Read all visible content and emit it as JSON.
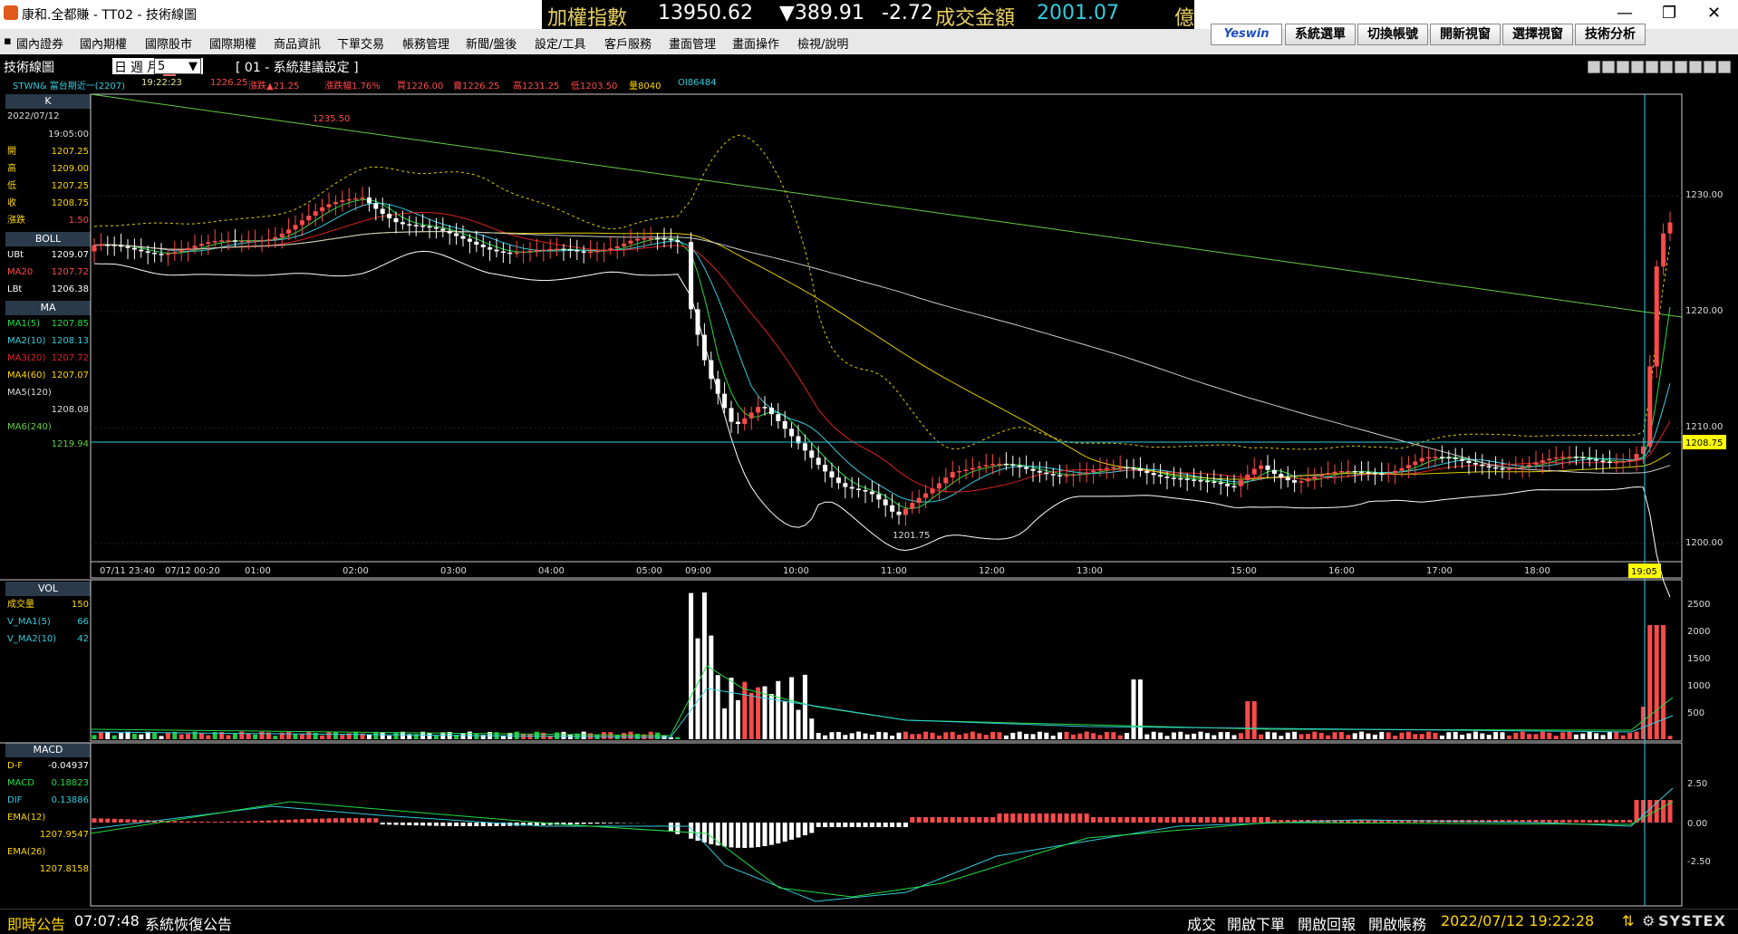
{
  "window": {
    "title": "康和.全都賺 - TT02 - 技術線圖",
    "ticker": {
      "index_name": "加權指數",
      "index_value": "13950.62",
      "change": "▼389.91",
      "change_pct": "-2.72%",
      "volume_label": "成交金額",
      "volume_value": "2001.07",
      "unit": "億"
    },
    "controls": {
      "minimize": "—",
      "maximize": "❐",
      "close": "✕"
    }
  },
  "menu": [
    "國內證券",
    "國內期權",
    "國際股市",
    "國際期權",
    "商品資訊",
    "下單交易",
    "帳務管理",
    "新聞/盤後",
    "設定/工具",
    "客戶服務",
    "畫面管理",
    "畫面操作",
    "檢視/說明"
  ],
  "toolbar": {
    "brand": "Yeswin",
    "buttons": [
      "系統選單",
      "切換帳號",
      "開新視窗",
      "選擇視窗",
      "技術分析"
    ]
  },
  "chart_header": {
    "panel_title": "技術線圖",
    "period_tabs": [
      "日",
      "週",
      "月",
      "分"
    ],
    "active_period": "分",
    "interval_value": "5",
    "preset": "[ 01 - 系統建議設定 ]",
    "quote_line": {
      "symbol": "STWN& 富台期近一(2207)",
      "time": "19:22:23",
      "last": "1226.25",
      "change": "漲跌▲21.25",
      "change_pct": "漲跌幅1.76%",
      "bid": "買1226.00",
      "ask": "賣1226.25",
      "high": "高1231.25",
      "low": "低1203.50",
      "volume": "量8040",
      "oi": "OI86484"
    }
  },
  "left_panel": {
    "k_title": "K",
    "date": "2022/07/12",
    "time": "19:05:00",
    "ohlc": [
      {
        "label": "開",
        "value": "1207.25"
      },
      {
        "label": "高",
        "value": "1209.00"
      },
      {
        "label": "低",
        "value": "1207.25"
      },
      {
        "label": "收",
        "value": "1208.75"
      },
      {
        "label": "漲跌",
        "value": "1.50"
      }
    ],
    "boll_title": "BOLL",
    "boll": [
      {
        "label": "UBt",
        "value": "1209.07"
      },
      {
        "label": "MA20",
        "value": "1207.72"
      },
      {
        "label": "LBt",
        "value": "1206.38"
      }
    ],
    "ma_title": "MA",
    "ma": [
      {
        "label": "MA1(5)",
        "value": "1207.85"
      },
      {
        "label": "MA2(10)",
        "value": "1208.13"
      },
      {
        "label": "MA3(20)",
        "value": "1207.72"
      },
      {
        "label": "MA4(60)",
        "value": "1207.07"
      },
      {
        "label": "MA5(120)",
        "value": "1208.08"
      },
      {
        "label": "MA6(240)",
        "value": "1219.94"
      }
    ],
    "vol_title": "VOL",
    "vol": [
      {
        "label": "成交量",
        "value": "150"
      },
      {
        "label": "V_MA1(5)",
        "value": "66"
      },
      {
        "label": "V_MA2(10)",
        "value": "42"
      }
    ],
    "macd_title": "MACD",
    "macd": [
      {
        "label": "D-F",
        "value": "-0.04937"
      },
      {
        "label": "MACD",
        "value": "0.18823"
      },
      {
        "label": "DIF",
        "value": "0.13886"
      },
      {
        "label": "EMA(12)",
        "value": "1207.9547"
      },
      {
        "label": "EMA(26)",
        "value": "1207.8158"
      }
    ]
  },
  "price_chart": {
    "y_ticks": [
      "1230.00",
      "1220.00",
      "1210.00",
      "1200.00"
    ],
    "current_price_tag": "1208.75",
    "high_annotation": "1235.50",
    "low_annotation": "1201.75",
    "x_ticks": [
      "07/11 23:40",
      "07/12 00:20",
      "01:00",
      "02:00",
      "03:00",
      "04:00",
      "05:00",
      "09:00",
      "10:00",
      "11:00",
      "12:00",
      "13:00",
      "15:00",
      "16:00",
      "17:00",
      "18:00"
    ],
    "cursor_time": "19:05"
  },
  "volume_chart": {
    "y_ticks": [
      "2500",
      "2000",
      "1500",
      "1000",
      "500"
    ]
  },
  "macd_chart": {
    "y_ticks": [
      "2.50",
      "0.00",
      "-2.50"
    ]
  },
  "colors": {
    "up": "#ff4a4a",
    "down": "#ffffff",
    "neutral_vol": "#22cc44",
    "ma5": "#22dd44",
    "ma10": "#33ccdd",
    "ma20": "#dd2222",
    "ma60": "#ddcc00",
    "ma120": "#cccccc",
    "ma240": "#66cc44",
    "boll": "#ffffff",
    "cursor": "#33ccdd"
  },
  "statusbar": {
    "label": "即時公告",
    "time": "07:07:48",
    "message": "系統恢復公告",
    "buttons": [
      "成交",
      "開啟下單",
      "開啟回報",
      "開啟帳務"
    ],
    "datetime": "2022/07/12 19:22:28",
    "brand": "SYSTEX"
  }
}
